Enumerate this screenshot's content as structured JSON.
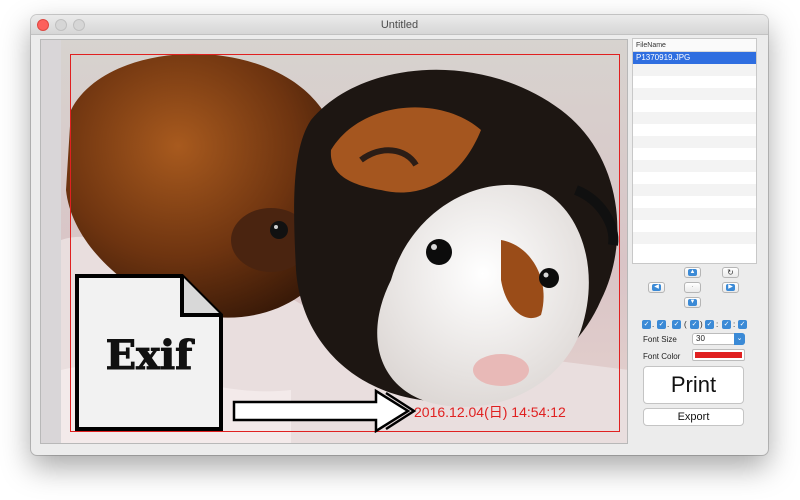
{
  "window": {
    "title": "Untitled"
  },
  "photo": {
    "exif_logo_text": "Exif",
    "stamp_text": "2016.12.04(日) 14:54:12",
    "stamp_color": "#e02020"
  },
  "file_list": {
    "header": "FileName",
    "files": [
      "P1370919.JPG"
    ]
  },
  "nav": {
    "icons": [
      "arrow-up-icon",
      "rotate-icon",
      "arrow-left-icon",
      "center-dot-icon",
      "arrow-right-icon",
      "arrow-down-icon"
    ]
  },
  "format_options": {
    "separators": [
      ".",
      ".",
      "(",
      ")",
      ":",
      ":"
    ],
    "checked": [
      true,
      true,
      true,
      true,
      true,
      true
    ]
  },
  "font_size": {
    "label": "Font Size",
    "value": "30"
  },
  "font_color": {
    "label": "Font Color",
    "value": "#e02020"
  },
  "actions": {
    "print_label": "Print",
    "export_label": "Export"
  }
}
